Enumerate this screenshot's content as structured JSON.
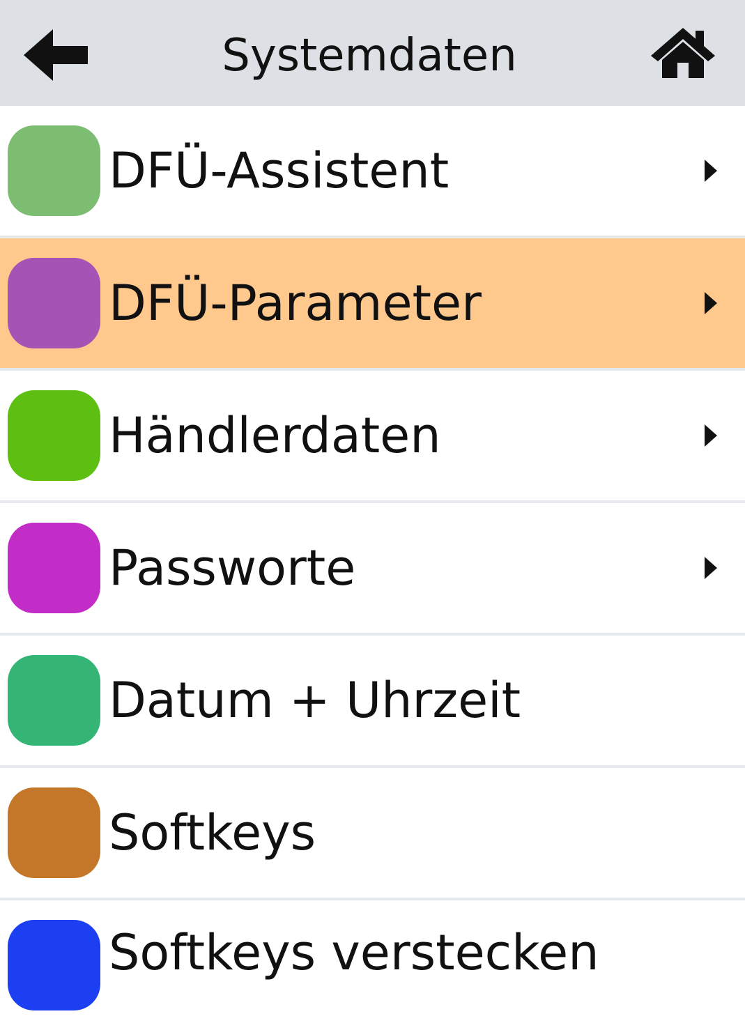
{
  "header": {
    "title": "Systemdaten",
    "back_icon": "arrow-left-icon",
    "home_icon": "home-icon"
  },
  "menu": {
    "items": [
      {
        "label": "DFÜ-Assistent",
        "color": "#7cbd72",
        "has_submenu": true,
        "selected": false
      },
      {
        "label": "DFÜ-Parameter",
        "color": "#a553b5",
        "has_submenu": true,
        "selected": true
      },
      {
        "label": "Händlerdaten",
        "color": "#5dbf12",
        "has_submenu": true,
        "selected": false
      },
      {
        "label": "Passworte",
        "color": "#c22dc8",
        "has_submenu": true,
        "selected": false
      },
      {
        "label": "Datum + Uhrzeit",
        "color": "#34b576",
        "has_submenu": false,
        "selected": false
      },
      {
        "label": "Softkeys",
        "color": "#c47629",
        "has_submenu": false,
        "selected": false
      },
      {
        "label": "Softkeys verstecken",
        "color": "#1c3ff2",
        "has_submenu": false,
        "selected": false
      }
    ]
  },
  "colors": {
    "header_bg": "#dde1e6",
    "selected_bg": "#ffc88c",
    "divider": "#e6e9ed"
  }
}
